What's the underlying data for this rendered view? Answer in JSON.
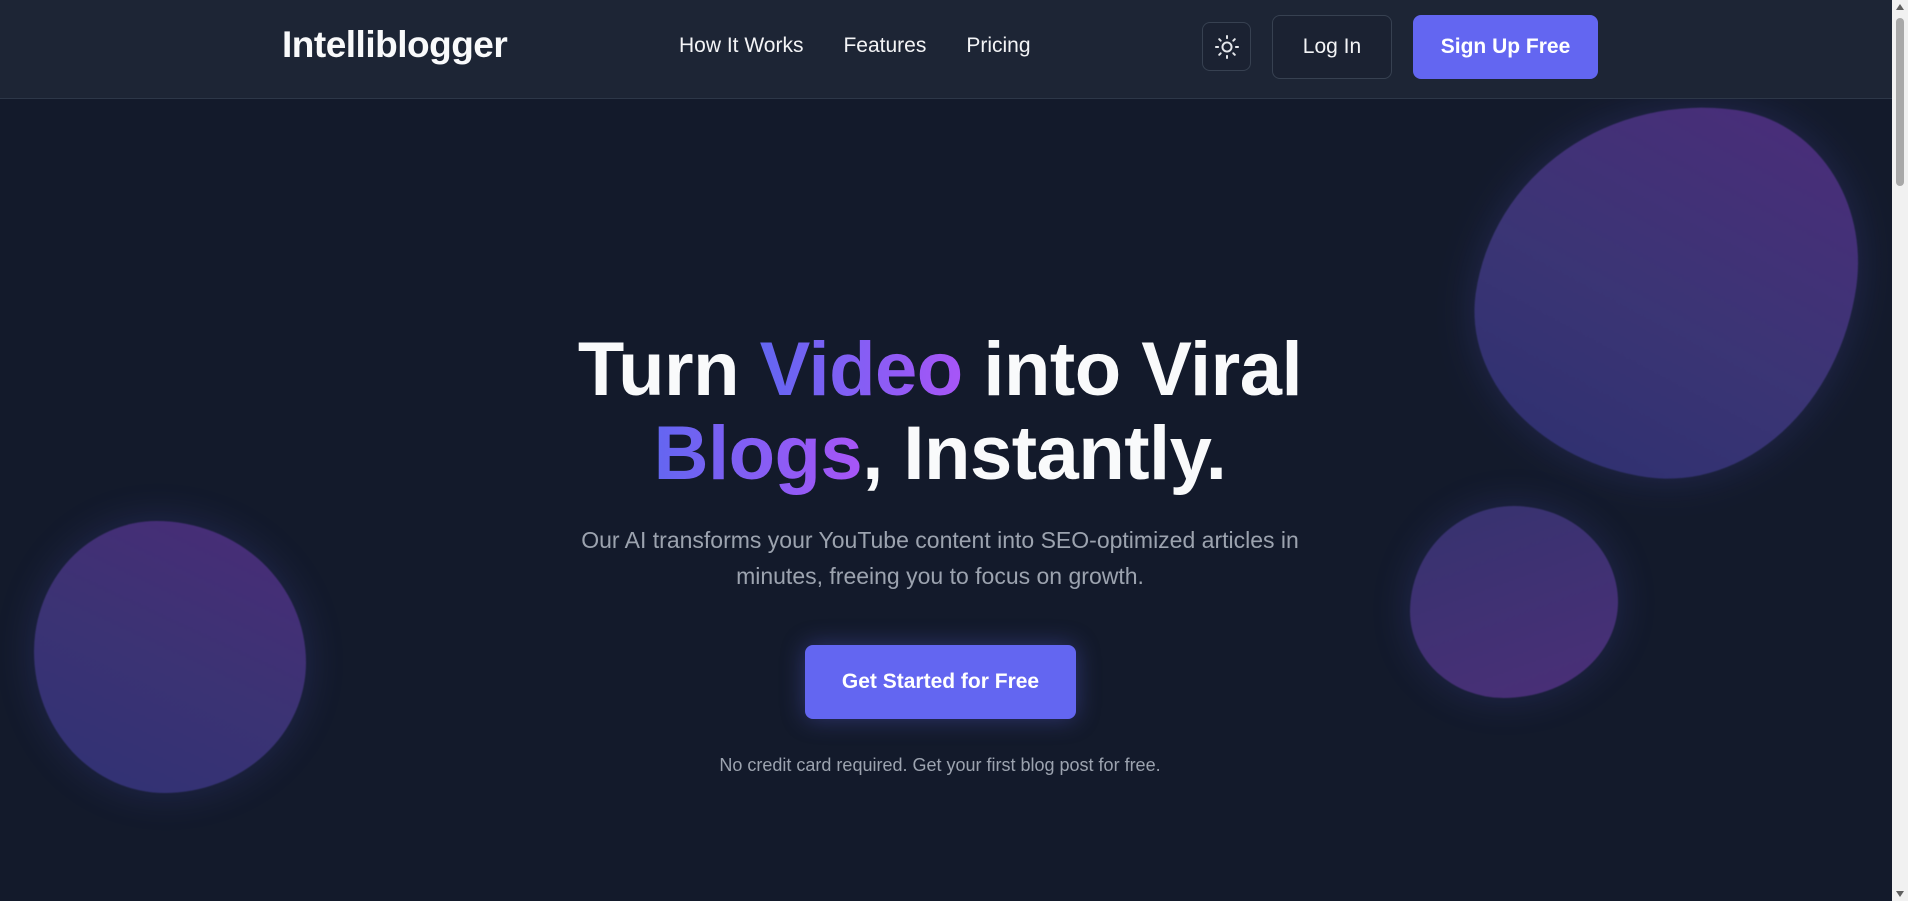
{
  "header": {
    "logo": "Intelliblogger",
    "nav": [
      {
        "label": "How It Works"
      },
      {
        "label": "Features"
      },
      {
        "label": "Pricing"
      }
    ],
    "theme_toggle_icon": "sun-icon",
    "login_label": "Log In",
    "signup_label": "Sign Up Free"
  },
  "hero": {
    "title_parts": {
      "p1": "Turn ",
      "highlight1": "Video",
      "p2": " into Viral",
      "highlight2": "Blogs",
      "p3": ", Instantly."
    },
    "subtitle": "Our AI transforms your YouTube content into SEO-optimized articles in minutes, freeing you to focus on growth.",
    "cta_label": "Get Started for Free",
    "note": "No credit card required. Get your first blog post for free."
  },
  "colors": {
    "accent": "#6366f1",
    "gradient_end": "#a855f7",
    "background": "#131a2b",
    "header_bg": "#1d2535"
  }
}
